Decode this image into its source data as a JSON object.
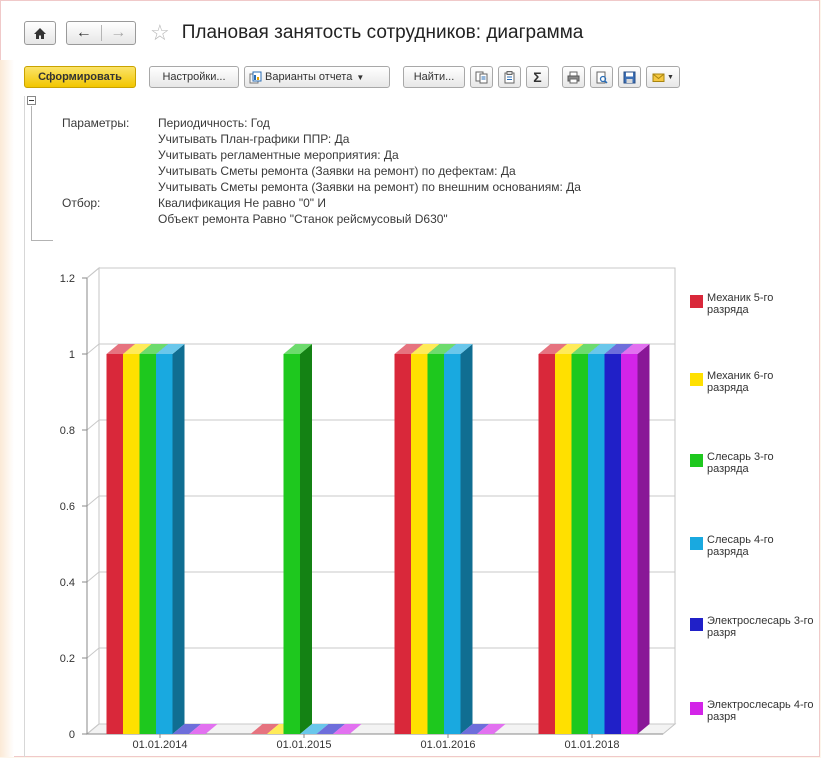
{
  "window": {
    "title": "Плановая занятость сотрудников: диаграмма"
  },
  "toolbar": {
    "generate_label": "Сформировать",
    "settings_label": "Настройки...",
    "variants_label": "Варианты отчета",
    "find_label": "Найти...",
    "sum_label": "Σ"
  },
  "parameters": {
    "label": "Параметры:",
    "lines": [
      "Периодичность: Год",
      "Учитывать План-графики ППР: Да",
      "Учитывать регламентные мероприятия: Да",
      "Учитывать Сметы ремонта (Заявки на ремонт) по дефектам: Да",
      "Учитывать Сметы ремонта (Заявки на ремонт) по внешним основаниям: Да"
    ]
  },
  "filter": {
    "label": "Отбор:",
    "lines": [
      "Квалификация Не равно \"0\" И",
      "Объект ремонта Равно \"Станок рейсмусовый D630\""
    ]
  },
  "chart_data": {
    "type": "bar",
    "categories": [
      "01.01.2014",
      "01.01.2015",
      "01.01.2016",
      "01.01.2018"
    ],
    "ylim": [
      0,
      1.2
    ],
    "yticks": [
      "0",
      "0.2",
      "0.4",
      "0.6",
      "0.8",
      "1",
      "1.2"
    ],
    "grid": true,
    "legend_position": "right",
    "series": [
      {
        "name": "Механик 5-го разряда",
        "color": "#d9283a",
        "values": [
          1,
          0,
          1,
          1
        ]
      },
      {
        "name": "Механик 6-го разряда",
        "color": "#ffe000",
        "values": [
          1,
          0,
          1,
          1
        ]
      },
      {
        "name": "Слесарь 3-го разряда",
        "color": "#1ec81e",
        "values": [
          1,
          1,
          1,
          1
        ]
      },
      {
        "name": "Слесарь 4-го разряда",
        "color": "#19a9e0",
        "values": [
          1,
          0,
          1,
          1
        ]
      },
      {
        "name": "Электрослесарь 3-го разря",
        "color": "#2020c8",
        "values": [
          0,
          0,
          0,
          1
        ]
      },
      {
        "name": "Электрослесарь 4-го разря",
        "color": "#d324e8",
        "values": [
          0,
          0,
          0,
          1
        ]
      }
    ]
  }
}
